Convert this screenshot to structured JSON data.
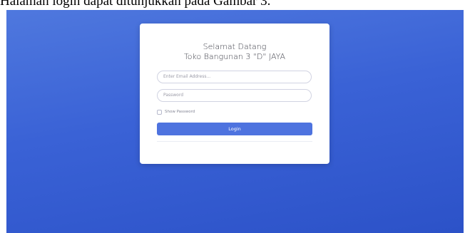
{
  "document": {
    "caption": "Halaman login dapat ditunjukkan pada Gambar 3."
  },
  "login_card": {
    "greeting": "Selamat Datang",
    "store_name": "Toko Bangunan 3 \"D\" JAYA",
    "email_placeholder": "Enter Email Address...",
    "email_value": "",
    "password_placeholder": "Password",
    "password_value": "",
    "show_password_label": "Show Password",
    "show_password_checked": false,
    "login_label": "Login"
  },
  "colors": {
    "background_gradient_top": "#4f78de",
    "background_gradient_bottom": "#2c52c8",
    "primary_button": "#4e73df",
    "card": "#ffffff"
  }
}
